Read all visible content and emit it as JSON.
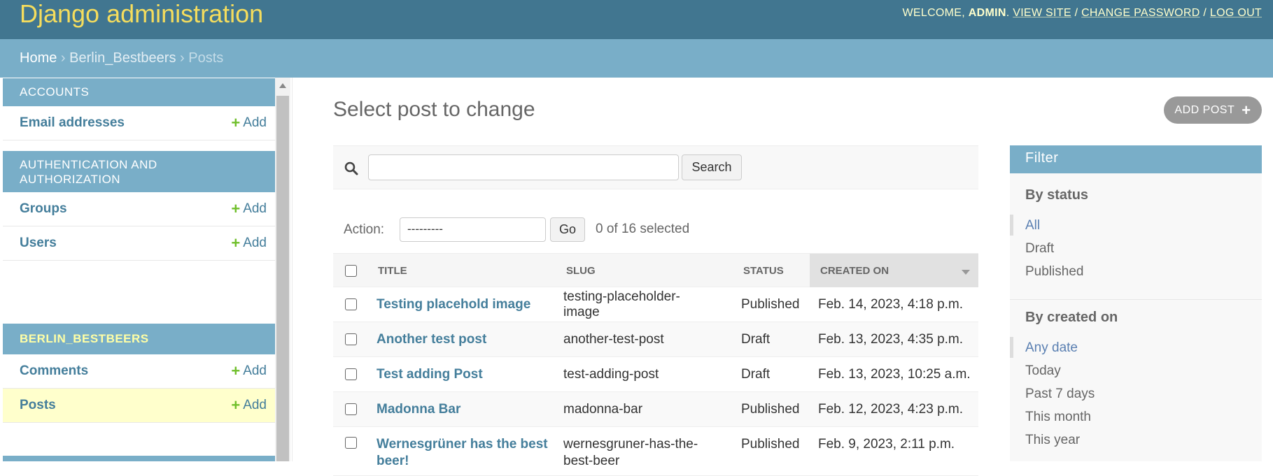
{
  "header": {
    "branding": "Django administration",
    "welcome": "Welcome,",
    "user": "admin",
    "view_site": "View site",
    "change_password": "Change password",
    "log_out": "Log out"
  },
  "breadcrumbs": {
    "home": "Home",
    "app": "Berlin_Bestbeers",
    "current": "Posts",
    "separator": "›"
  },
  "sidebar": {
    "apps": [
      {
        "caption": "Accounts",
        "models": [
          {
            "name": "Email addresses",
            "add": "Add"
          }
        ]
      },
      {
        "caption": "Authentication and Authorization",
        "models": [
          {
            "name": "Groups",
            "add": "Add"
          },
          {
            "name": "Users",
            "add": "Add"
          }
        ]
      },
      {
        "caption": "Berlin_Bestbeers",
        "models": [
          {
            "name": "Comments",
            "add": "Add"
          },
          {
            "name": "Posts",
            "add": "Add"
          }
        ]
      }
    ]
  },
  "content": {
    "title": "Select post to change",
    "add_button": "Add post",
    "search_button": "Search",
    "search_value": "",
    "action_label": "Action:",
    "action_value": "---------",
    "go_button": "Go",
    "selected_count": "0 of 16 selected"
  },
  "table": {
    "columns": [
      "Title",
      "Slug",
      "Status",
      "Created on"
    ],
    "rows": [
      {
        "title": "Testing placehold image",
        "slug": "testing-placeholder-image",
        "status": "Published",
        "created": "Feb. 14, 2023, 4:18 p.m."
      },
      {
        "title": "Another test post",
        "slug": "another-test-post",
        "status": "Draft",
        "created": "Feb. 13, 2023, 4:35 p.m."
      },
      {
        "title": "Test adding Post",
        "slug": "test-adding-post",
        "status": "Draft",
        "created": "Feb. 13, 2023, 10:25 a.m."
      },
      {
        "title": "Madonna Bar",
        "slug": "madonna-bar",
        "status": "Published",
        "created": "Feb. 12, 2023, 4:23 p.m."
      },
      {
        "title": "Wernesgrüner has the best beer!",
        "slug": "wernesgruner-has-the-best-beer",
        "status": "Published",
        "created": "Feb. 9, 2023, 2:11 p.m."
      }
    ]
  },
  "filter": {
    "title": "Filter",
    "by_status": "By status",
    "status_options": [
      "All",
      "Draft",
      "Published"
    ],
    "by_created": "By created on",
    "created_options": [
      "Any date",
      "Today",
      "Past 7 days",
      "This month",
      "This year"
    ]
  },
  "colors": {
    "header": "#417690",
    "breadcrumbs": "#79aec8",
    "branding": "#f5dd5d",
    "link": "#447e9b",
    "add_plus": "#70bf2b",
    "current_model_bg": "#ffffcc"
  },
  "icons": [
    "search-icon",
    "plus-icon",
    "sort-descending-icon",
    "scroll-up-arrow-icon"
  ]
}
